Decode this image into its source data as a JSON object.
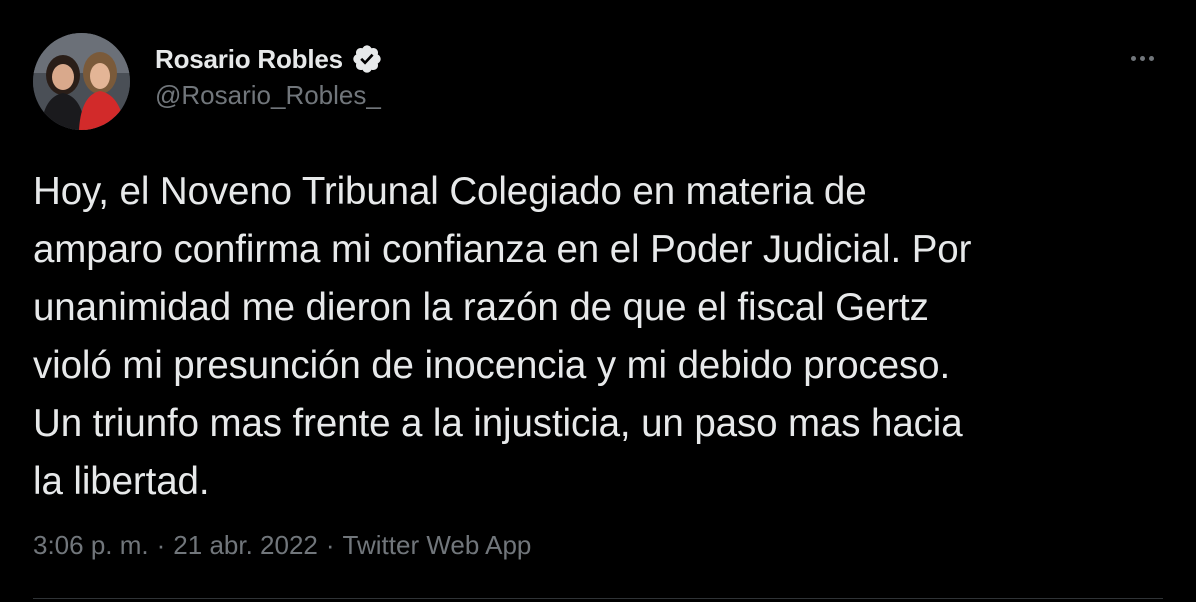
{
  "tweet": {
    "author": {
      "name": "Rosario Robles",
      "handle": "@Rosario_Robles_",
      "verified": true,
      "avatar": "profile-photo"
    },
    "text": "Hoy, el Noveno Tribunal Colegiado en materia de\namparo confirma mi confianza en el Poder Judicial. Por\nunanimidad me dieron la razón de que el fiscal Gertz\nvioló mi presunción de inocencia y mi debido proceso.\nUn triunfo mas frente a la injusticia, un paso mas hacia\nla libertad.",
    "time": "3:06 p. m.",
    "date": "21 abr. 2022",
    "source": "Twitter Web App",
    "separator": "·",
    "more_icon": "more-options-icon"
  },
  "colors": {
    "background": "#000000",
    "primary_text": "#e7e9ea",
    "secondary_text": "#71767b",
    "verified_badge": "#e7e9ea"
  }
}
